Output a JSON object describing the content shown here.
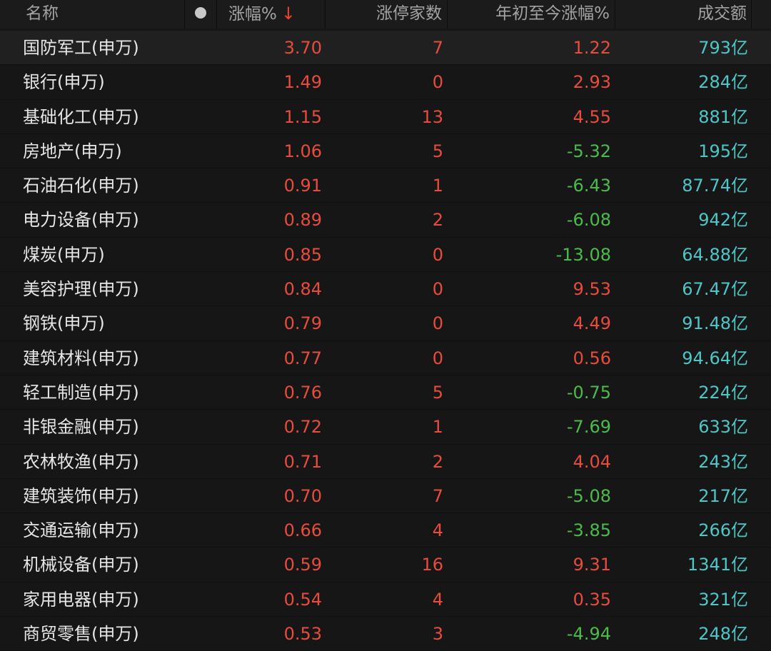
{
  "columns": {
    "name": "名称",
    "change": "涨幅%",
    "sort_arrow": "↓",
    "limit_up": "涨停家数",
    "ytd": "年初至今涨幅%",
    "volume": "成交额"
  },
  "rows": [
    {
      "name": "国防军工(申万)",
      "change": "3.70",
      "limit_up": "7",
      "ytd": "1.22",
      "ytd_dir": "up",
      "volume": "793亿"
    },
    {
      "name": "银行(申万)",
      "change": "1.49",
      "limit_up": "0",
      "ytd": "2.93",
      "ytd_dir": "up",
      "volume": "284亿"
    },
    {
      "name": "基础化工(申万)",
      "change": "1.15",
      "limit_up": "13",
      "ytd": "4.55",
      "ytd_dir": "up",
      "volume": "881亿"
    },
    {
      "name": "房地产(申万)",
      "change": "1.06",
      "limit_up": "5",
      "ytd": "-5.32",
      "ytd_dir": "down",
      "volume": "195亿"
    },
    {
      "name": "石油石化(申万)",
      "change": "0.91",
      "limit_up": "1",
      "ytd": "-6.43",
      "ytd_dir": "down",
      "volume": "87.74亿"
    },
    {
      "name": "电力设备(申万)",
      "change": "0.89",
      "limit_up": "2",
      "ytd": "-6.08",
      "ytd_dir": "down",
      "volume": "942亿"
    },
    {
      "name": "煤炭(申万)",
      "change": "0.85",
      "limit_up": "0",
      "ytd": "-13.08",
      "ytd_dir": "down",
      "volume": "64.88亿"
    },
    {
      "name": "美容护理(申万)",
      "change": "0.84",
      "limit_up": "0",
      "ytd": "9.53",
      "ytd_dir": "up",
      "volume": "67.47亿"
    },
    {
      "name": "钢铁(申万)",
      "change": "0.79",
      "limit_up": "0",
      "ytd": "4.49",
      "ytd_dir": "up",
      "volume": "91.48亿"
    },
    {
      "name": "建筑材料(申万)",
      "change": "0.77",
      "limit_up": "0",
      "ytd": "0.56",
      "ytd_dir": "up",
      "volume": "94.64亿"
    },
    {
      "name": "轻工制造(申万)",
      "change": "0.76",
      "limit_up": "5",
      "ytd": "-0.75",
      "ytd_dir": "down",
      "volume": "224亿"
    },
    {
      "name": "非银金融(申万)",
      "change": "0.72",
      "limit_up": "1",
      "ytd": "-7.69",
      "ytd_dir": "down",
      "volume": "633亿"
    },
    {
      "name": "农林牧渔(申万)",
      "change": "0.71",
      "limit_up": "2",
      "ytd": "4.04",
      "ytd_dir": "up",
      "volume": "243亿"
    },
    {
      "name": "建筑装饰(申万)",
      "change": "0.70",
      "limit_up": "7",
      "ytd": "-5.08",
      "ytd_dir": "down",
      "volume": "217亿"
    },
    {
      "name": "交通运输(申万)",
      "change": "0.66",
      "limit_up": "4",
      "ytd": "-3.85",
      "ytd_dir": "down",
      "volume": "266亿"
    },
    {
      "name": "机械设备(申万)",
      "change": "0.59",
      "limit_up": "16",
      "ytd": "9.31",
      "ytd_dir": "up",
      "volume": "1341亿"
    },
    {
      "name": "家用电器(申万)",
      "change": "0.54",
      "limit_up": "4",
      "ytd": "0.35",
      "ytd_dir": "up",
      "volume": "321亿"
    },
    {
      "name": "商贸零售(申万)",
      "change": "0.53",
      "limit_up": "3",
      "ytd": "-4.94",
      "ytd_dir": "down",
      "volume": "248亿"
    }
  ],
  "colors": {
    "up": "#e74c3c",
    "down": "#4cbb4c",
    "volume": "#4fc6c6",
    "background": "#161616"
  }
}
